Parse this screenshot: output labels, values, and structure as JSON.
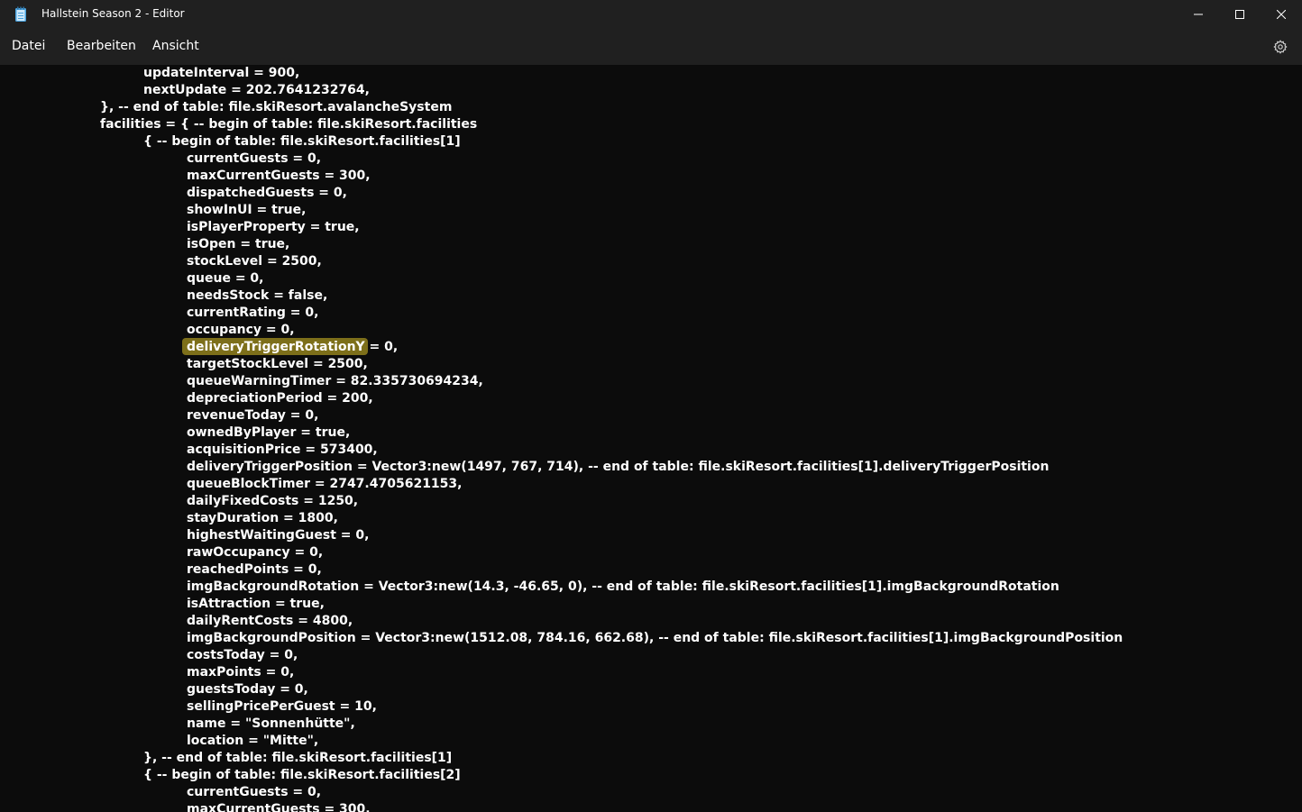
{
  "window": {
    "title": "Hallstein Season 2 - Editor",
    "app_icon": "notepad-icon"
  },
  "menu": {
    "items": [
      "Datei",
      "Bearbeiten",
      "Ansicht"
    ],
    "settings_icon": "gear-icon"
  },
  "editor": {
    "highlighted_line_index": 16,
    "highlight_color": "#8a7a1c",
    "lines": [
      {
        "indent": 2,
        "text": "updateInterval = 900,"
      },
      {
        "indent": 2,
        "text": "nextUpdate = 202.7641232764,"
      },
      {
        "indent": 1,
        "text": "}, -- end of table: file.skiResort.avalancheSystem"
      },
      {
        "indent": 1,
        "text": "facilities = { -- begin of table: file.skiResort.facilities"
      },
      {
        "indent": 2,
        "text": "{ -- begin of table: file.skiResort.facilities[1]"
      },
      {
        "indent": 3,
        "text": "currentGuests = 0,"
      },
      {
        "indent": 3,
        "text": "maxCurrentGuests = 300,"
      },
      {
        "indent": 3,
        "text": "dispatchedGuests = 0,"
      },
      {
        "indent": 3,
        "text": "showInUI = true,"
      },
      {
        "indent": 3,
        "text": "isPlayerProperty = true,"
      },
      {
        "indent": 3,
        "text": "isOpen = true,"
      },
      {
        "indent": 3,
        "text": "stockLevel = 2500,"
      },
      {
        "indent": 3,
        "text": "queue = 0,"
      },
      {
        "indent": 3,
        "text": "needsStock = false,"
      },
      {
        "indent": 3,
        "text": "currentRating = 0,"
      },
      {
        "indent": 3,
        "text": "occupancy = 0,"
      },
      {
        "indent": 3,
        "text": "deliveryTriggerRotationY = 0,"
      },
      {
        "indent": 3,
        "text": "targetStockLevel = 2500,"
      },
      {
        "indent": 3,
        "text": "queueWarningTimer = 82.335730694234,"
      },
      {
        "indent": 3,
        "text": "depreciationPeriod = 200,"
      },
      {
        "indent": 3,
        "text": "revenueToday = 0,"
      },
      {
        "indent": 3,
        "text": "ownedByPlayer = true,"
      },
      {
        "indent": 3,
        "text": "acquisitionPrice = 573400,"
      },
      {
        "indent": 3,
        "text": "deliveryTriggerPosition = Vector3:new(1497, 767, 714), -- end of table: file.skiResort.facilities[1].deliveryTriggerPosition"
      },
      {
        "indent": 3,
        "text": "queueBlockTimer = 2747.4705621153,"
      },
      {
        "indent": 3,
        "text": "dailyFixedCosts = 1250,"
      },
      {
        "indent": 3,
        "text": "stayDuration = 1800,"
      },
      {
        "indent": 3,
        "text": "highestWaitingGuest = 0,"
      },
      {
        "indent": 3,
        "text": "rawOccupancy = 0,"
      },
      {
        "indent": 3,
        "text": "reachedPoints = 0,"
      },
      {
        "indent": 3,
        "text": "imgBackgroundRotation = Vector3:new(14.3, -46.65, 0), -- end of table: file.skiResort.facilities[1].imgBackgroundRotation"
      },
      {
        "indent": 3,
        "text": "isAttraction = true,"
      },
      {
        "indent": 3,
        "text": "dailyRentCosts = 4800,"
      },
      {
        "indent": 3,
        "text": "imgBackgroundPosition = Vector3:new(1512.08, 784.16, 662.68), -- end of table: file.skiResort.facilities[1].imgBackgroundPosition"
      },
      {
        "indent": 3,
        "text": "costsToday = 0,"
      },
      {
        "indent": 3,
        "text": "maxPoints = 0,"
      },
      {
        "indent": 3,
        "text": "guestsToday = 0,"
      },
      {
        "indent": 3,
        "text": "sellingPricePerGuest = 10,"
      },
      {
        "indent": 3,
        "text": "name = \"Sonnenhütte\","
      },
      {
        "indent": 3,
        "text": "location = \"Mitte\","
      },
      {
        "indent": 2,
        "text": "}, -- end of table: file.skiResort.facilities[1]"
      },
      {
        "indent": 2,
        "text": "{ -- begin of table: file.skiResort.facilities[2]"
      },
      {
        "indent": 3,
        "text": "currentGuests = 0,"
      },
      {
        "indent": 3,
        "text": "maxCurrentGuests = 300,"
      }
    ]
  }
}
